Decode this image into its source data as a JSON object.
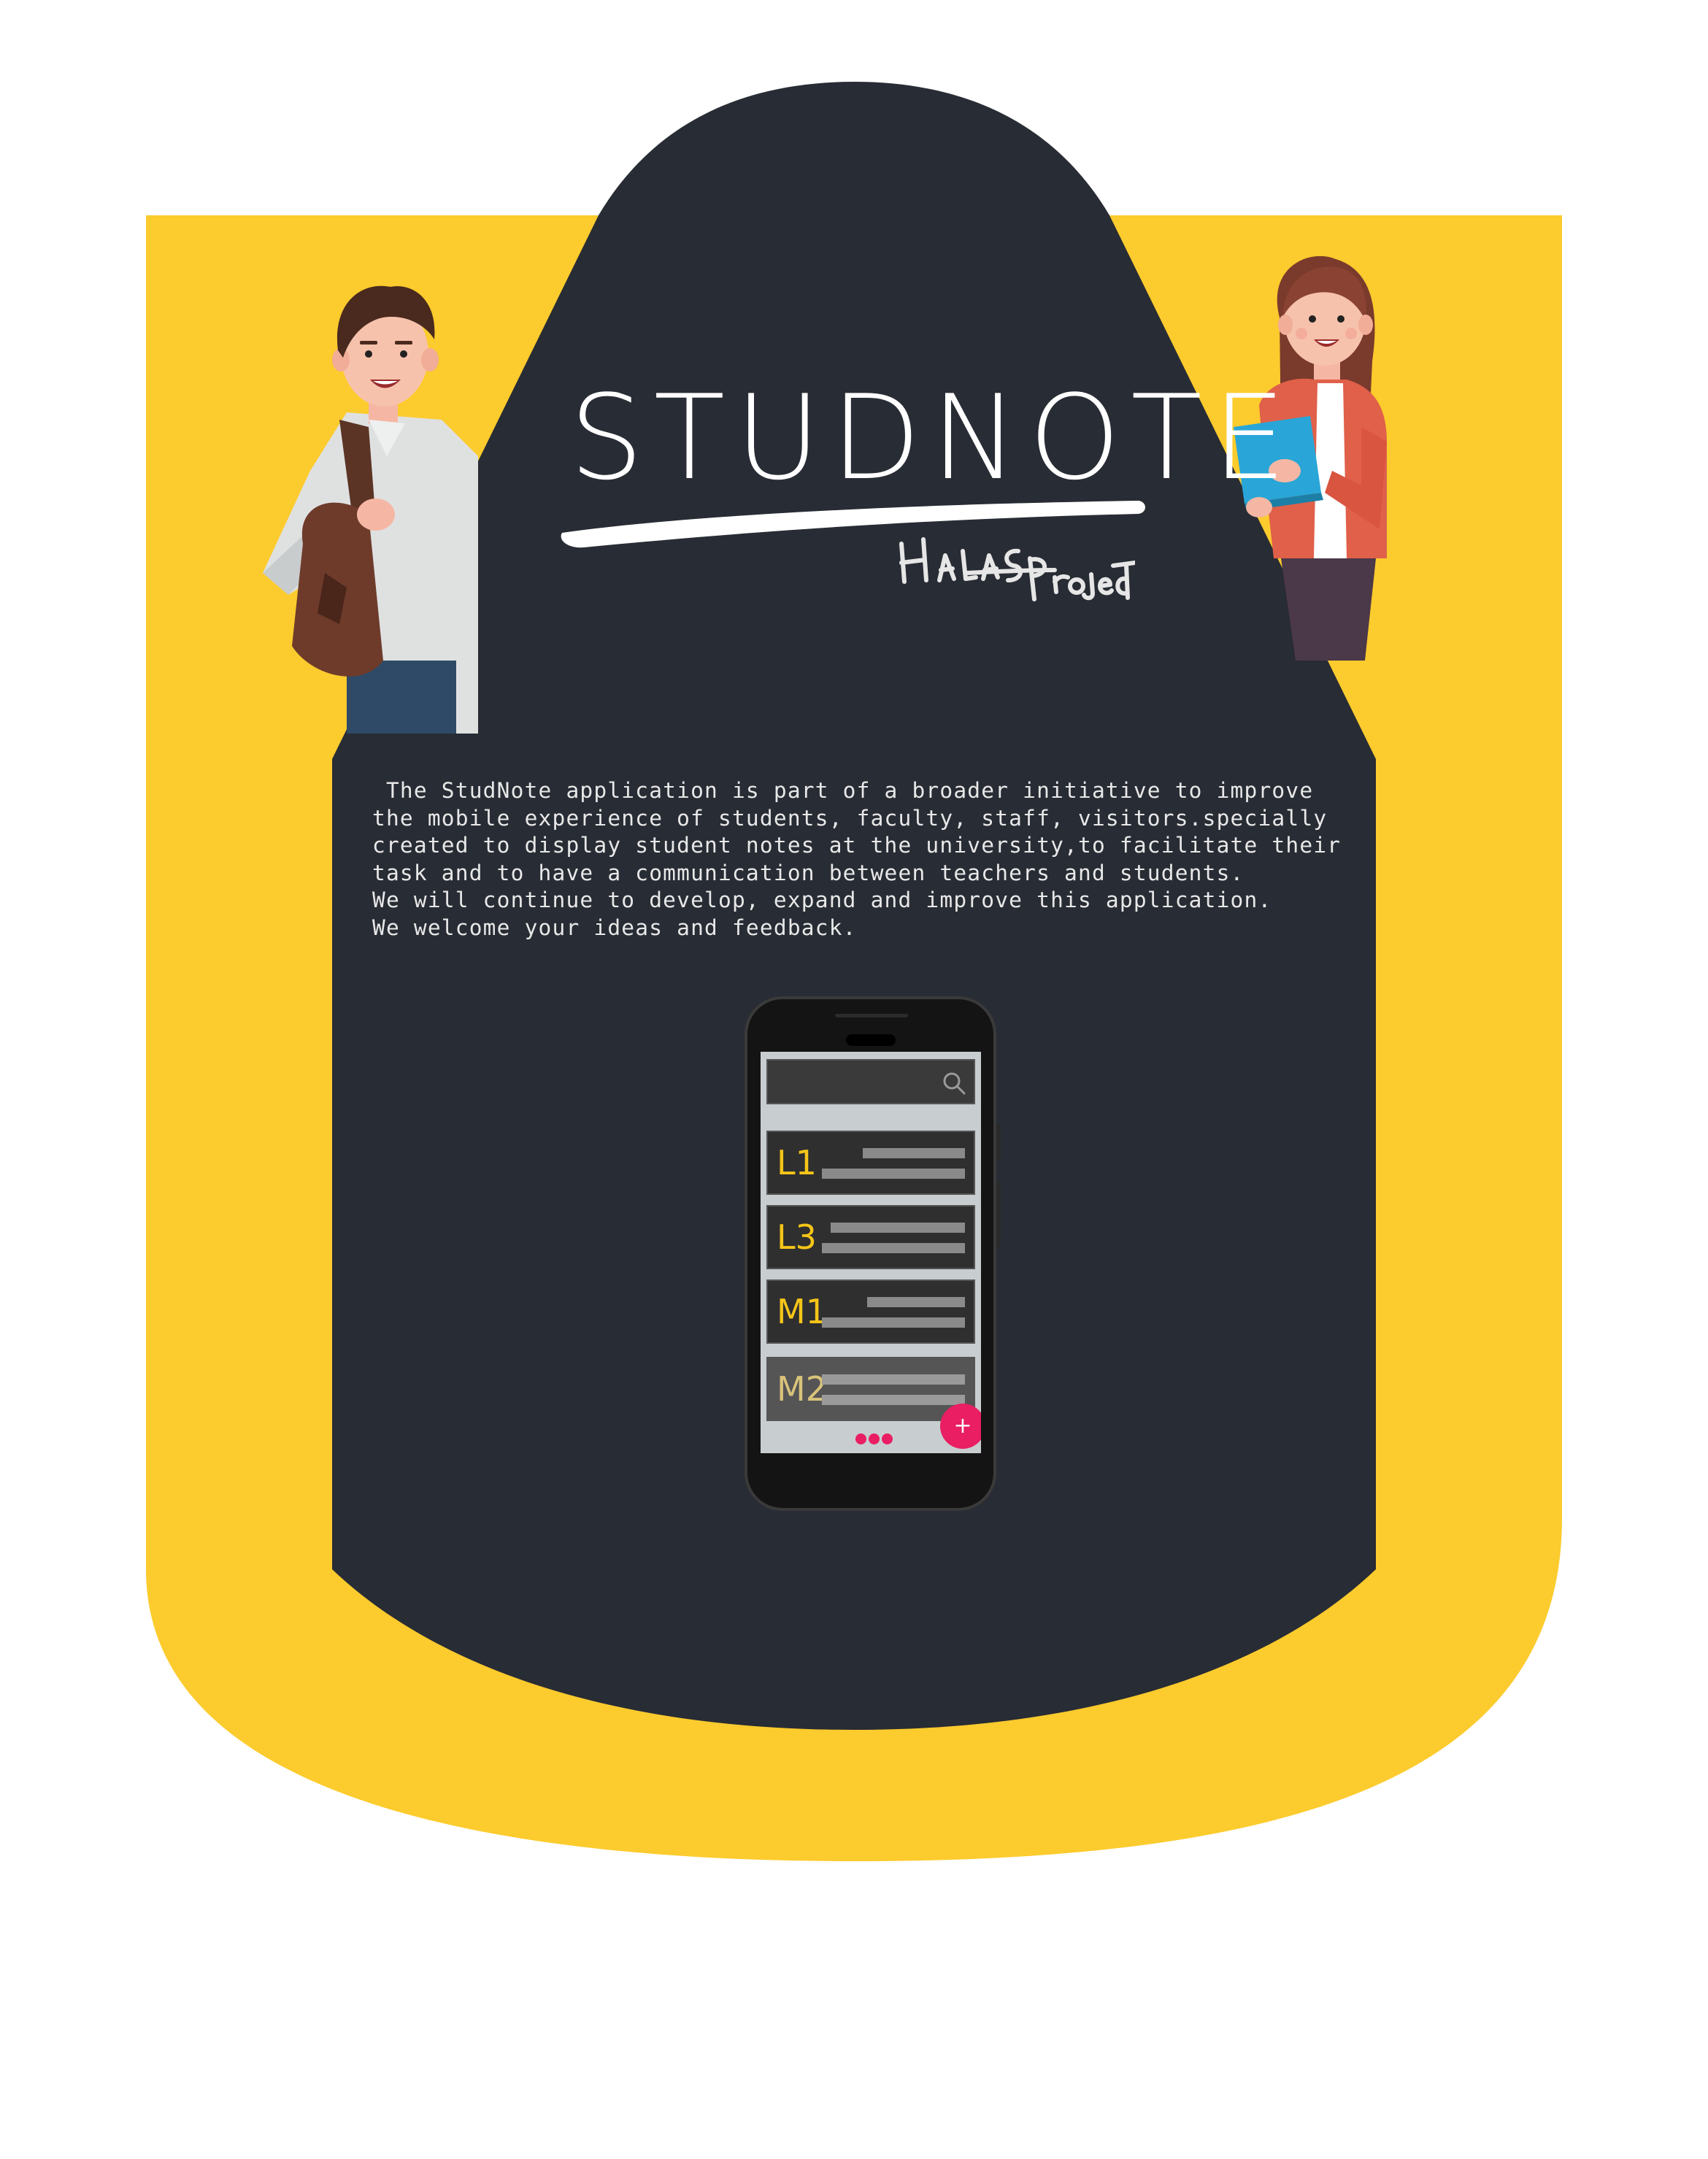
{
  "brand": {
    "title": "STUDNOTE",
    "signature": "Halas Project"
  },
  "description": {
    "lines": [
      " The StudNote application is part of a broader initiative to improve",
      "the mobile experience of students, faculty, staff, visitors.specially",
      "created to display student notes at the university,to facilitate their",
      "task and to have a communication between teachers and students.",
      "We will continue to develop, expand and improve this application.",
      "We welcome your ideas and feedback."
    ]
  },
  "phone_mockup": {
    "search_icon": "search-icon",
    "items": [
      {
        "label": "L1"
      },
      {
        "label": "L3"
      },
      {
        "label": "M1"
      },
      {
        "label": "M2"
      }
    ],
    "fab_label": "+",
    "nav_icon": "more-dots-icon"
  },
  "illustrations": {
    "left": "student-boy-with-backpack",
    "right": "student-girl-with-books"
  },
  "colors": {
    "accent_yellow": "#fccb2d",
    "panel_dark": "#282c34",
    "text_light": "#e8e8e8",
    "phone_label_yellow": "#f5c518",
    "fab_pink": "#e91e63"
  }
}
